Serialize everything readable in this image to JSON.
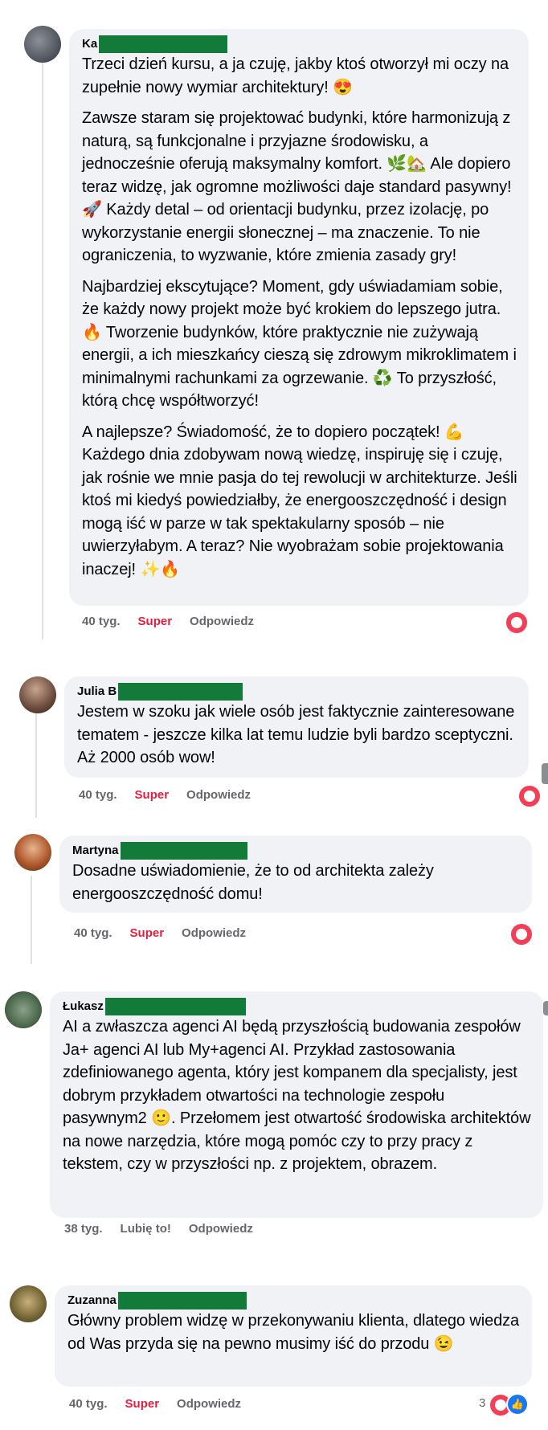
{
  "comments": [
    {
      "author": "Ka",
      "paragraphs": [
        "Trzeci dzień kursu, a ja czuję, jakby ktoś otworzył mi oczy na zupełnie nowy wymiar architektury! 😍",
        "Zawsze staram się projektować budynki, które harmonizują z naturą, są funkcjonalne i przyjazne środowisku, a jednocześnie oferują maksymalny komfort. 🌿🏡 Ale dopiero teraz widzę, jak ogromne możliwości daje standard pasywny! 🚀 Każdy detal – od orientacji budynku, przez izolację, po wykorzystanie energii słonecznej – ma znaczenie. To nie ograniczenia, to wyzwanie, które zmienia zasady gry!",
        "Najbardziej ekscytujące? Moment, gdy uświadamiam sobie, że każdy nowy projekt może być krokiem do lepszego jutra. 🔥 Tworzenie budynków, które praktycznie nie zużywają energii, a ich mieszkańcy cieszą się zdrowym mikroklimatem i minimalnymi rachunkami za ogrzewanie. ♻️ To przyszłość, którą chcę współtworzyć!",
        "A najlepsze? Świadomość, że to dopiero początek! 💪 Każdego dnia zdobywam nową wiedzę, inspiruję się i czuję, jak rośnie we mnie pasja do tej rewolucji w architekturze. Jeśli ktoś mi kiedyś powiedziałby, że energooszczędność i design mogą iść w parze w tak spektakularny sposób – nie uwierzyłabym. A teraz? Nie wyobrażam sobie projektowania inaczej! ✨🔥"
      ],
      "time": "40 tyg.",
      "reaction_label": "Super",
      "reply_label": "Odpowiedz"
    },
    {
      "author": "Julia B",
      "paragraphs": [
        "Jestem w szoku jak wiele osób jest faktycznie zainteresowane tematem - jeszcze kilka lat temu ludzie byli bardzo sceptyczni. Aż 2000 osób wow!"
      ],
      "time": "40 tyg.",
      "reaction_label": "Super",
      "reply_label": "Odpowiedz"
    },
    {
      "author": "Martyna",
      "paragraphs": [
        "Dosadne uświadomienie, że to od architekta zależy energooszczędność domu!"
      ],
      "time": "40 tyg.",
      "reaction_label": "Super",
      "reply_label": "Odpowiedz"
    },
    {
      "author": "Łukasz",
      "paragraphs": [
        "AI a zwłaszcza agenci AI będą przyszłością budowania zespołów Ja+ agenci AI lub My+agenci AI. Przykład zastosowania zdefiniowanego agenta, który jest kompanem dla specjalisty, jest dobrym przykładem otwartości na technologie zespołu pasywnym2 🙂. Przełomem jest otwartość środowiska architektów na nowe narzędzia, które mogą pomóc czy to przy pracy z tekstem, czy w przyszłości np. z projektem, obrazem."
      ],
      "time": "38 tyg.",
      "reaction_label": "Lubię to!",
      "reply_label": "Odpowiedz"
    },
    {
      "author": "Zuzanna",
      "paragraphs": [
        "Główny problem widzę w przekonywaniu klienta, dlatego wiedza od Was przyda się na pewno musimy iść do przodu 😉"
      ],
      "time": "40 tyg.",
      "reaction_label": "Super",
      "reply_label": "Odpowiedz",
      "reaction_count": "3"
    }
  ],
  "colors": {
    "bubble": "#f0f2f5",
    "redaction": "#137b3a",
    "super": "#e41e3f",
    "heart": "#f33e58",
    "like": "#1877f2",
    "meta": "#65676b"
  }
}
